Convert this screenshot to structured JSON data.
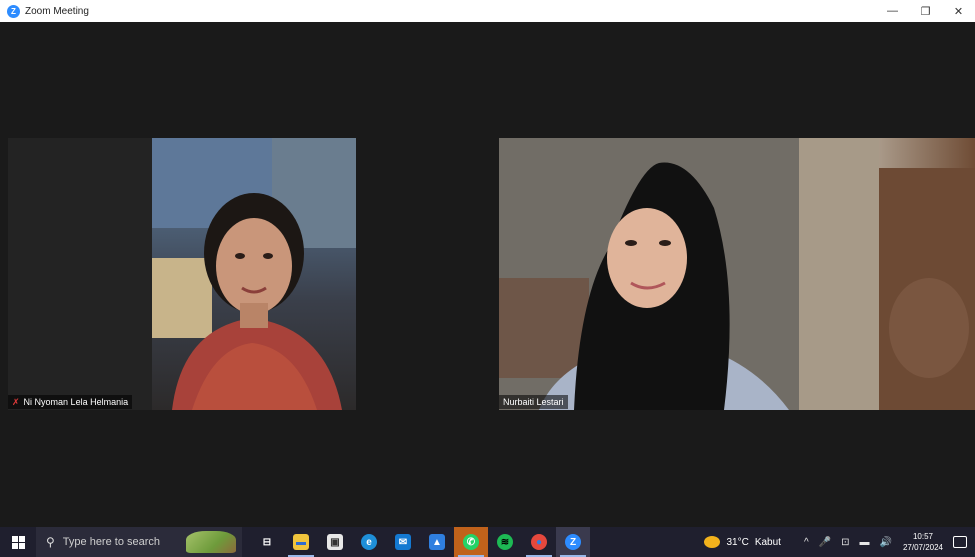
{
  "window": {
    "title": "Zoom Meeting",
    "app_icon_letter": "Z",
    "controls": {
      "minimize": "—",
      "restore": "❐",
      "close": "✕"
    }
  },
  "participants": [
    {
      "name": "Ni Nyoman Lela Helmania",
      "muted": true
    },
    {
      "name": "Nurbaiti Lestari",
      "muted": false
    }
  ],
  "taskbar": {
    "search_placeholder": "Type here to search",
    "apps": [
      {
        "name": "task-view",
        "glyph": "⊟",
        "color": "#1f1f2e"
      },
      {
        "name": "file-explorer",
        "glyph": "▬",
        "color": "#f0c43c"
      },
      {
        "name": "store",
        "glyph": "▣",
        "color": "#e8e8e8"
      },
      {
        "name": "edge",
        "glyph": "e",
        "color": "#1e8fd8"
      },
      {
        "name": "mail",
        "glyph": "✉",
        "color": "#1479d1"
      },
      {
        "name": "photos",
        "glyph": "▲",
        "color": "#2f7fe0"
      },
      {
        "name": "whatsapp",
        "glyph": "✆",
        "color": "#25d366"
      },
      {
        "name": "spotify",
        "glyph": "≋",
        "color": "#1db954"
      },
      {
        "name": "chrome",
        "glyph": "●",
        "color": "#e5483d"
      },
      {
        "name": "zoom",
        "glyph": "Z",
        "color": "#2d8cff"
      }
    ],
    "weather": {
      "temp": "31°C",
      "condition": "Kabut"
    },
    "tray_symbols": [
      "^",
      "🎤",
      "⊡",
      "▬",
      "🔊"
    ],
    "time": "10:57",
    "date": "27/07/2024"
  }
}
